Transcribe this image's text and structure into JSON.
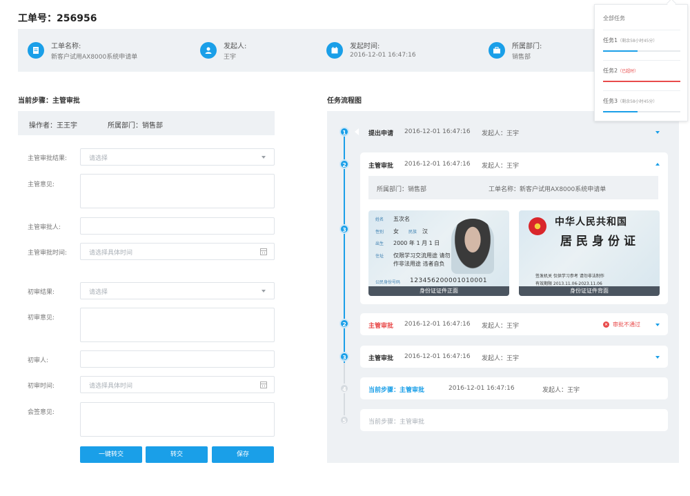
{
  "header": {
    "title": "工单号：256956"
  },
  "info": [
    {
      "label": "工单名称:",
      "value": "新客户试用AX8000系统申请单",
      "icon": "document-icon"
    },
    {
      "label": "发起人:",
      "value": "王宇",
      "icon": "user-icon"
    },
    {
      "label": "发起时间:",
      "value": "2016-12-01 16:47:16",
      "icon": "calendar-icon"
    },
    {
      "label": "所属部门:",
      "value": "销售部",
      "icon": "briefcase-icon"
    }
  ],
  "left": {
    "section_title": "当前步骤：主管审批",
    "operator_label": "操作者：王王宇",
    "department_label": "所属部门：销售部",
    "fields": {
      "supervisor_result": {
        "label": "主管审批结果:",
        "placeholder": "请选择"
      },
      "supervisor_opinion": {
        "label": "主管意见:"
      },
      "supervisor_approver": {
        "label": "主管审批人:"
      },
      "supervisor_time": {
        "label": "主管审批时间:",
        "placeholder": "请选择具体时间"
      },
      "initial_result": {
        "label": "初审结果:",
        "placeholder": "请选择"
      },
      "initial_opinion": {
        "label": "初审意见:"
      },
      "initial_person": {
        "label": "初审人:"
      },
      "initial_time": {
        "label": "初审时间:",
        "placeholder": "请选择具体时间"
      },
      "countersign_opinion": {
        "label": "会签意见:"
      }
    },
    "buttons": {
      "quick_transfer": "一键转交",
      "transfer": "转交",
      "save": "保存"
    }
  },
  "flow": {
    "section_title": "任务流程图",
    "steps": [
      {
        "num": "1",
        "title": "提出申请",
        "time": "2016-12-01 16:47:16",
        "person": "发起人：王宇"
      },
      {
        "num": "2",
        "title": "主管审批",
        "time": "2016-12-01 16:47:16",
        "person": "发起人：王宇",
        "detail_dept": "所属部门：销售部",
        "detail_name": "工单名称：新客户试用AX8000系统申请单"
      },
      {
        "num": "3"
      },
      {
        "num": "2",
        "title": "主管审批",
        "time": "2016-12-01 16:47:16",
        "person": "发起人：王宇",
        "status": "审批不通过"
      },
      {
        "num": "3",
        "title": "主管审批",
        "time": "2016-12-01 16:47:16",
        "person": "发起人：王宇"
      },
      {
        "num": "4",
        "title": "当前步骤：主管审批",
        "time": "2016-12-01 16:47:16",
        "person": "发起人：王宇"
      },
      {
        "num": "5",
        "title": "当前步骤：主管审批"
      }
    ],
    "id_front": {
      "name_label": "姓名",
      "name": "五次名",
      "gender_label": "性别",
      "gender": "女",
      "ethnicity_label": "民族",
      "ethnicity": "汉",
      "birth_label": "出生",
      "birth": "2000 年 1 月 1 日",
      "address_label": "住址",
      "address1": "仅限学习交流用途 请勿",
      "address2": "作非法用途 违者自负",
      "number_label": "公民身份号码",
      "number": "123456200001010001",
      "caption": "身份证证件正面"
    },
    "id_back": {
      "country": "中华人民共和国",
      "title": "居民身份证",
      "authority": "签发机关 仅供学习参考 请勿非法制作",
      "validity": "有效期限 2013.11.06-2023.11.06",
      "caption": "身份证证件背面"
    }
  },
  "popover": {
    "header": "全部任务",
    "tasks": [
      {
        "label": "任务1",
        "note": "（剩余58小时45分）",
        "progress": 0.45,
        "overdue": false
      },
      {
        "label": "任务2",
        "note": "（已超时）",
        "progress": 1.0,
        "overdue": true
      },
      {
        "label": "任务3",
        "note": "（剩余58小时45分）",
        "progress": 0.45,
        "overdue": false
      }
    ]
  },
  "colors": {
    "accent": "#1a9fe8",
    "danger": "#e84a4a",
    "panel": "#eef1f4"
  }
}
